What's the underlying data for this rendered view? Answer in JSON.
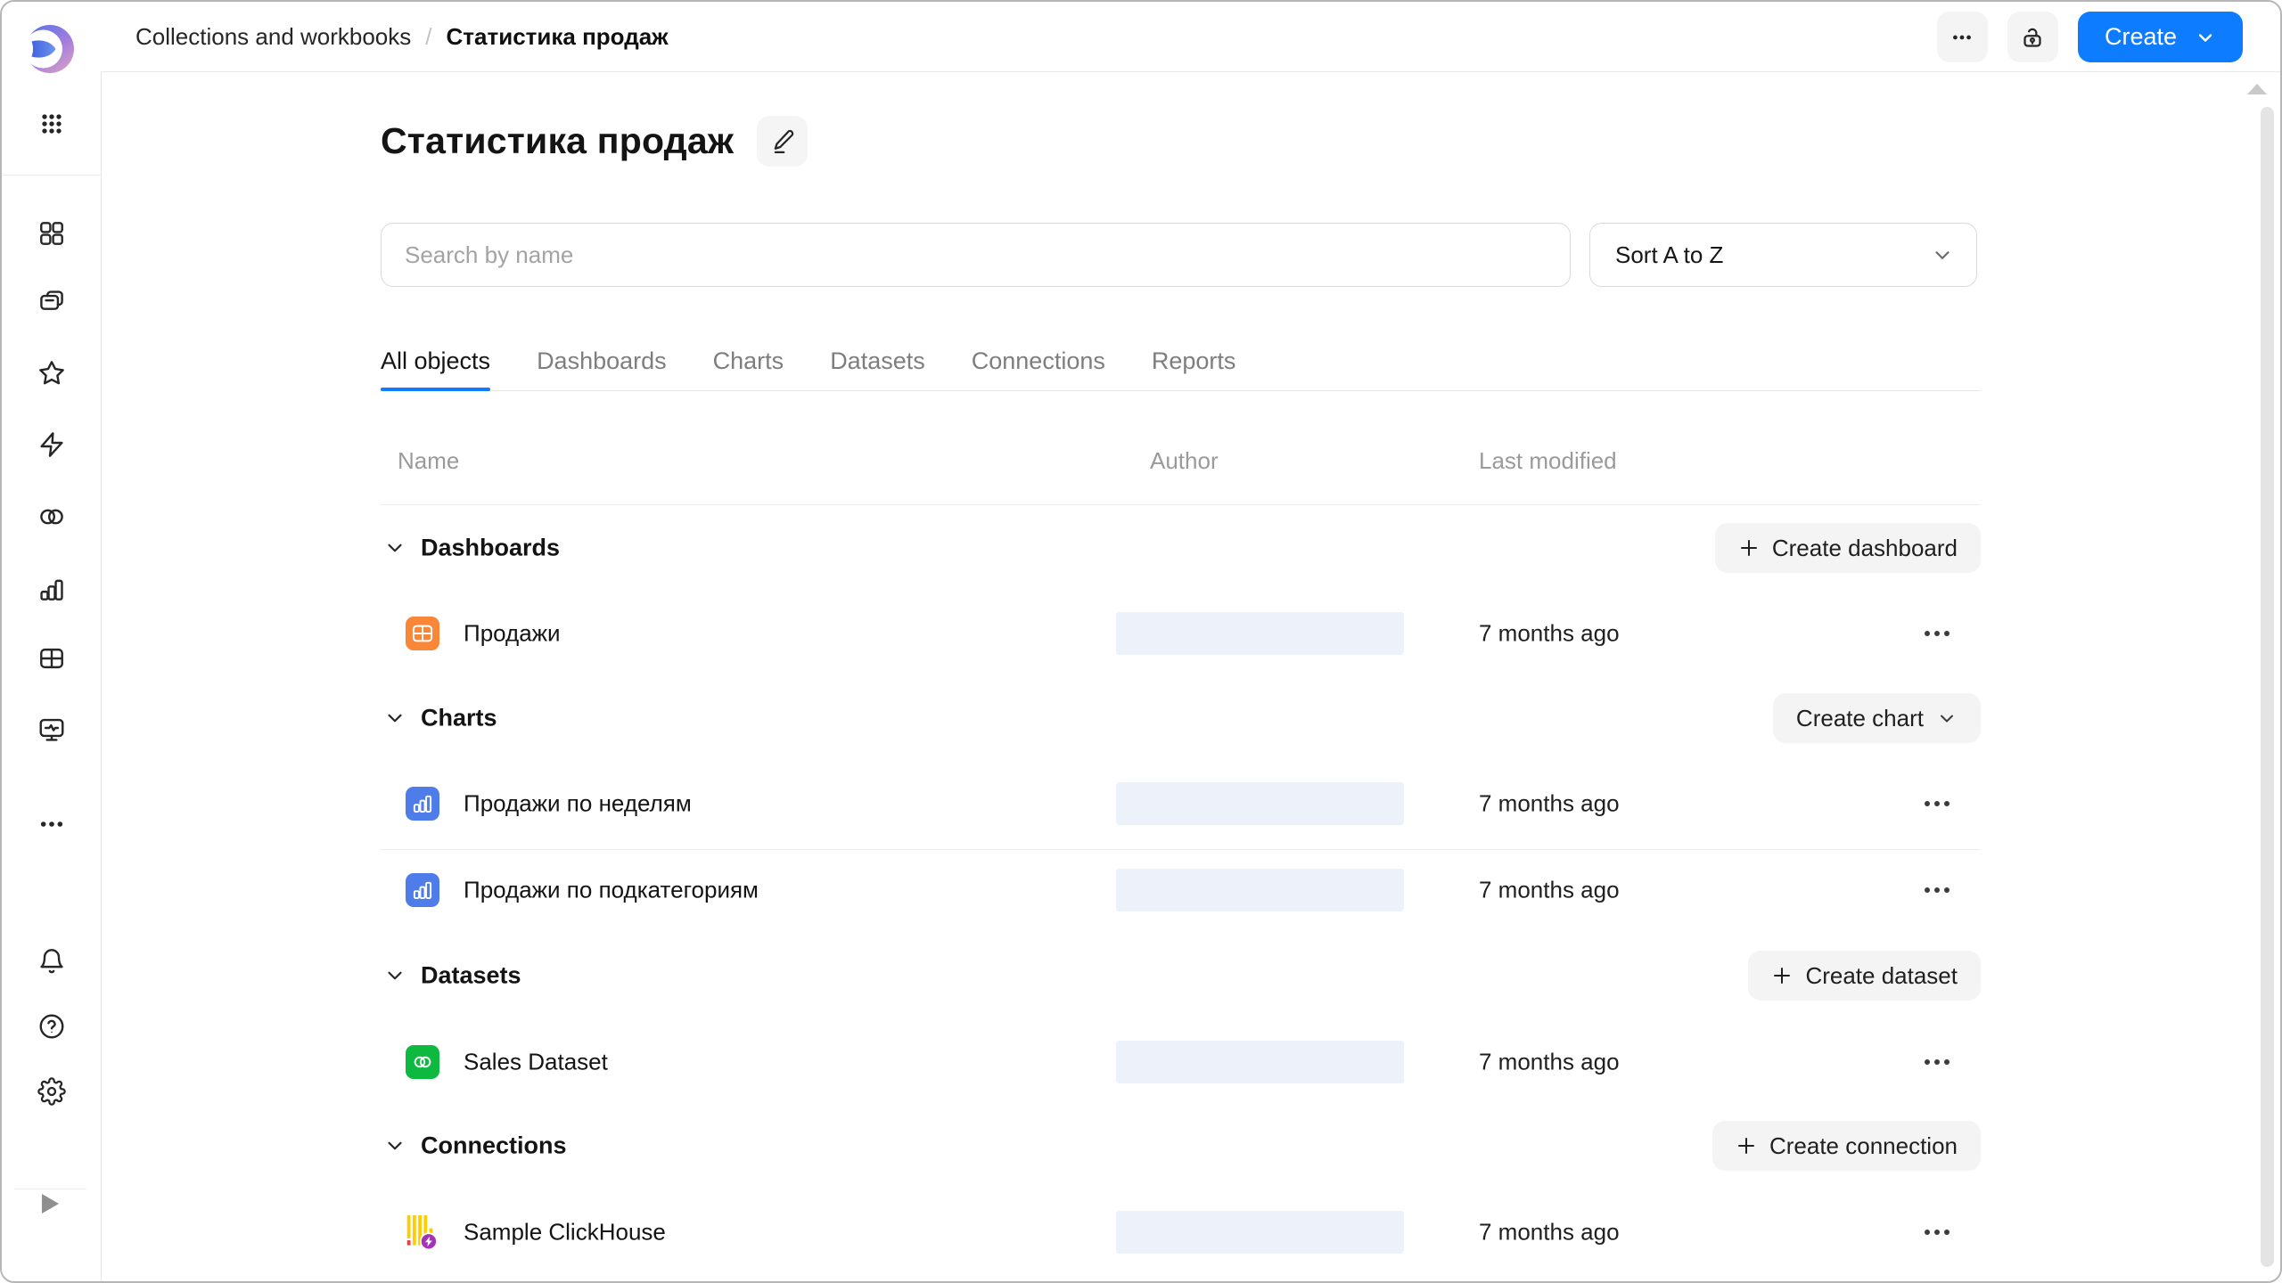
{
  "window": {
    "breadcrumbs": [
      "Collections and workbooks",
      "Статистика продаж"
    ],
    "breadcrumb_separator": "/",
    "create_button": "Create"
  },
  "page": {
    "title": "Статистика продаж"
  },
  "toolbar": {
    "search_placeholder": "Search by name",
    "sort_value": "Sort A to Z"
  },
  "tabs": [
    {
      "label": "All objects",
      "active": true
    },
    {
      "label": "Dashboards",
      "active": false
    },
    {
      "label": "Charts",
      "active": false
    },
    {
      "label": "Datasets",
      "active": false
    },
    {
      "label": "Connections",
      "active": false
    },
    {
      "label": "Reports",
      "active": false
    }
  ],
  "table": {
    "columns": [
      "Name",
      "Author",
      "Last modified"
    ]
  },
  "sections": [
    {
      "label": "Dashboards",
      "action_label": "Create dashboard",
      "action_icon": "plus",
      "rows": [
        {
          "name": "Продажи",
          "icon": "dashboard-icon",
          "modified": "7 months ago"
        }
      ]
    },
    {
      "label": "Charts",
      "action_label": "Create chart",
      "action_icon": "chevron-down",
      "rows": [
        {
          "name": "Продажи по неделям",
          "icon": "chart-icon",
          "modified": "7 months ago"
        },
        {
          "name": "Продажи по подкатегориям",
          "icon": "chart-icon",
          "modified": "7 months ago"
        }
      ]
    },
    {
      "label": "Datasets",
      "action_label": "Create dataset",
      "action_icon": "plus",
      "rows": [
        {
          "name": "Sales Dataset",
          "icon": "dataset-icon",
          "modified": "7 months ago"
        }
      ]
    },
    {
      "label": "Connections",
      "action_label": "Create connection",
      "action_icon": "plus",
      "rows": [
        {
          "name": "Sample ClickHouse",
          "icon": "clickhouse-icon",
          "modified": "7 months ago"
        }
      ]
    }
  ],
  "sidebar_icons": [
    "apps-menu",
    "objects-grid",
    "collections",
    "favorites",
    "quick-actions",
    "datasets",
    "charts",
    "dashboards",
    "monitoring",
    "more",
    "notifications",
    "help",
    "settings",
    "collapse"
  ],
  "colors": {
    "accent_blue": "#0e7cff",
    "dashboard_icon": "#fa8638",
    "chart_icon": "#4e7de9",
    "dataset_icon": "#0dba3f",
    "clickhouse_yellow": "#ffcc00",
    "clickhouse_red": "#f53b3b",
    "clickhouse_badge": "#a234b5",
    "skeleton": "#edf1fa"
  }
}
